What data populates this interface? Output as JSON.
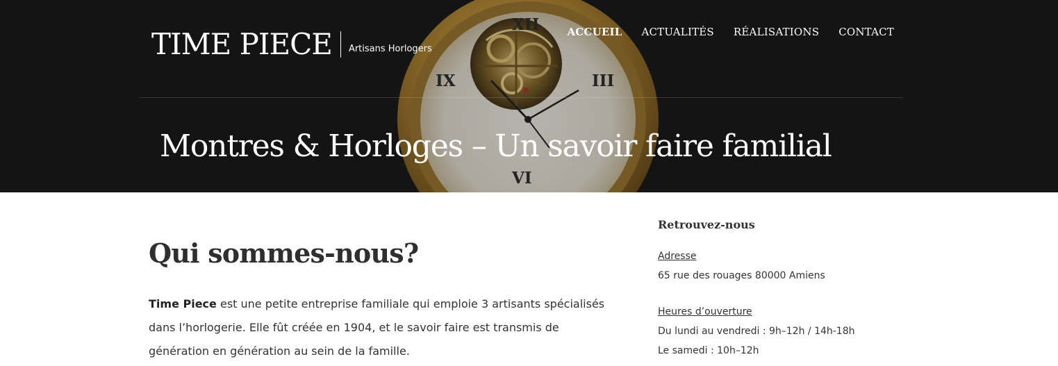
{
  "header": {
    "brand_name": "TIME PIECE",
    "brand_tagline": "Artisans Horlogers",
    "nav": [
      {
        "label": "ACCUEIL",
        "active": true
      },
      {
        "label": "ACTUALITÉS",
        "active": false
      },
      {
        "label": "RÉALISATIONS",
        "active": false
      },
      {
        "label": "CONTACT",
        "active": false
      }
    ],
    "hero_title": "Montres & Horloges – Un savoir faire familial",
    "background_image": "pocket-watch-image"
  },
  "main": {
    "heading": "Qui sommes-nous?",
    "intro_bold": "Time Piece",
    "intro_text": " est une petite entreprise familiale qui emploie 3 artisants spécialisés dans l’horlogerie. Elle fût créée en 1904, et le savoir faire est transmis de génération en génération au sein de la famille."
  },
  "sidebar": {
    "title": "Retrouvez-nous",
    "address_label": "Adresse",
    "address_value": "65 rue des rouages 80000 Amiens",
    "hours_label": "Heures d’ouverture",
    "hours_lines": [
      "Du lundi au vendredi : 9h–12h / 14h-18h",
      "Le samedi : 10h–12h"
    ]
  },
  "colors": {
    "hero_background": "#141414",
    "text_dark": "#333333",
    "white": "#ffffff",
    "watch_gold": "#b8913a"
  }
}
